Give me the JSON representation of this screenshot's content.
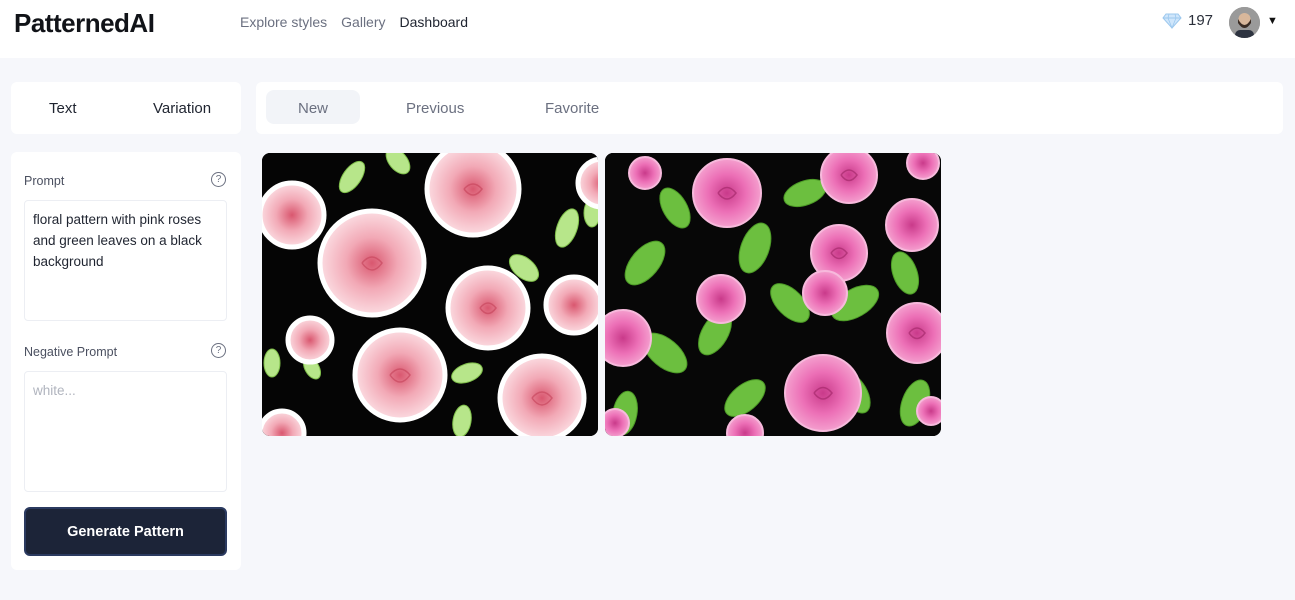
{
  "header": {
    "logo": "PatternedAI",
    "nav": [
      {
        "label": "Explore styles"
      },
      {
        "label": "Gallery"
      },
      {
        "label": "Dashboard"
      }
    ],
    "credits": "197",
    "credits_icon": "diamond-icon"
  },
  "mode_tabs": [
    {
      "label": "Text"
    },
    {
      "label": "Variation"
    }
  ],
  "form": {
    "prompt_label": "Prompt",
    "prompt_value": "floral pattern with pink roses and green leaves on a black background",
    "negative_label": "Negative Prompt",
    "negative_placeholder": "white...",
    "generate_label": "Generate Pattern"
  },
  "result_tabs": [
    {
      "label": "New"
    },
    {
      "label": "Previous"
    },
    {
      "label": "Favorite"
    }
  ],
  "colors": {
    "button_bg": "#1c2438",
    "background": "#f6f7fb",
    "rose_light": "#f2a9b6",
    "rose_hot": "#ec6fb6",
    "leaf_light": "#b7e68a",
    "leaf_green": "#6cbf3f"
  }
}
